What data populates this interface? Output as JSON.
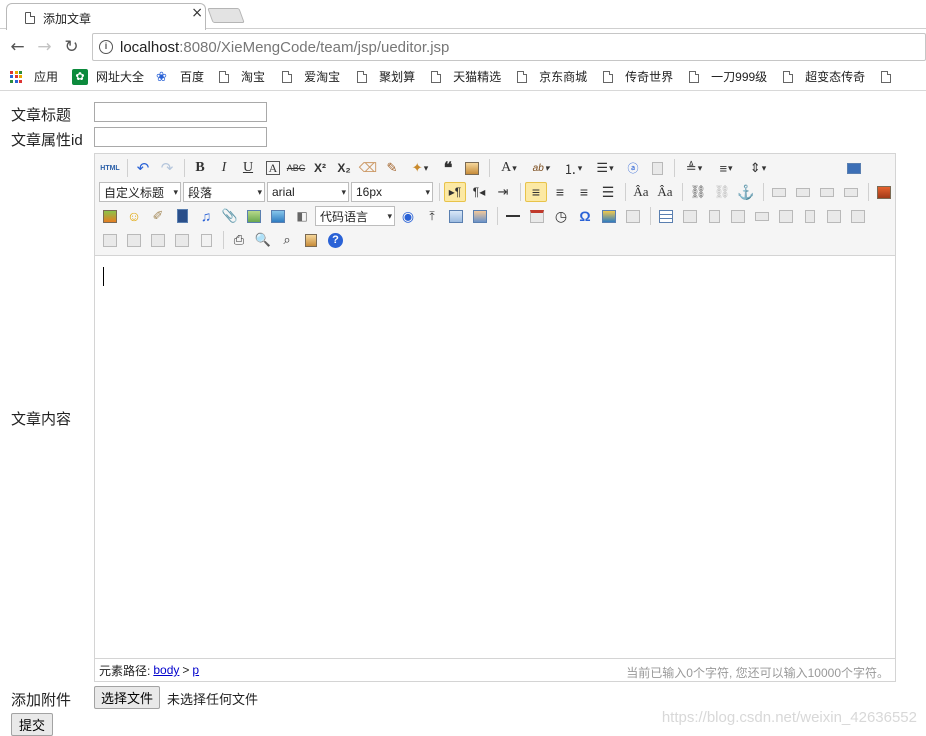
{
  "browser": {
    "tab_title": "添加文章",
    "tab_close": "×",
    "url_host": "localhost",
    "url_rest": ":8080/XieMengCode/team/jsp/ueditor.jsp",
    "bookmarks": [
      "应用",
      "网址大全",
      "百度",
      "淘宝",
      "爱淘宝",
      "聚划算",
      "天猫精选",
      "京东商城",
      "传奇世界",
      "一刀999级",
      "超变态传奇"
    ]
  },
  "form": {
    "title_label": "文章标题",
    "attr_label": "文章属性id",
    "content_label": "文章内容",
    "attach_label": "添加附件",
    "file_button": "选择文件",
    "file_status": "未选择任何文件",
    "submit": "提交"
  },
  "editor": {
    "custom_heading": "自定义标题",
    "paragraph": "段落",
    "font_family": "arial",
    "font_size": "16px",
    "code_lang": "代码语言",
    "path_label": "元素路径:",
    "path_body": "body",
    "path_p": "p",
    "word_count": "当前已输入0个字符, 您还可以输入10000个字符。"
  },
  "watermark": "https://blog.csdn.net/weixin_42636552"
}
